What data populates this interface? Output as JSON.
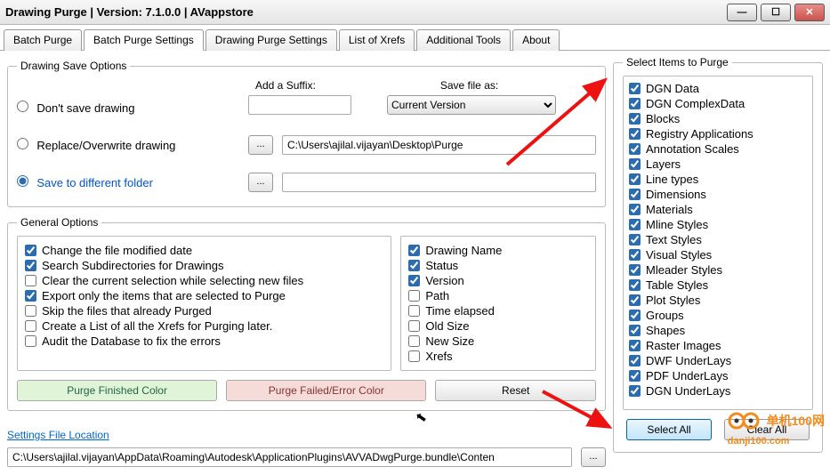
{
  "window": {
    "title": "Drawing Purge  | Version: 7.1.0.0  |  AVappstore"
  },
  "tabs": [
    "Batch Purge",
    "Batch Purge Settings",
    "Drawing Purge Settings",
    "List of Xrefs",
    "Additional Tools",
    "About"
  ],
  "active_tab_index": 1,
  "save_options": {
    "legend": "Drawing Save Options",
    "radio_dont_save": "Don't save drawing",
    "radio_replace": "Replace/Overwrite drawing",
    "radio_savefolder": "Save to different folder",
    "suffix_label": "Add a Suffix:",
    "suffix_value": "",
    "saveas_label": "Save file as:",
    "saveas_value": "Current Version",
    "replace_path": "C:\\Users\\ajilal.vijayan\\Desktop\\Purge",
    "savefolder_path": "",
    "browse_label": "..."
  },
  "general_options": {
    "legend": "General Options",
    "left": [
      {
        "label": "Change the file modified date",
        "checked": true
      },
      {
        "label": "Search Subdirectories for Drawings",
        "checked": true
      },
      {
        "label": "Clear the current selection while selecting new files",
        "checked": false
      },
      {
        "label": "Export only the items that are selected to Purge",
        "checked": true
      },
      {
        "label": "Skip the files that already Purged",
        "checked": false
      },
      {
        "label": "Create a List of all the Xrefs for Purging later.",
        "checked": false
      },
      {
        "label": "Audit the Database to fix the errors",
        "checked": false
      }
    ],
    "right": [
      {
        "label": "Drawing Name",
        "checked": true
      },
      {
        "label": "Status",
        "checked": true
      },
      {
        "label": "Version",
        "checked": true
      },
      {
        "label": "Path",
        "checked": false
      },
      {
        "label": "Time elapsed",
        "checked": false
      },
      {
        "label": "Old Size",
        "checked": false
      },
      {
        "label": "New Size",
        "checked": false
      },
      {
        "label": "Xrefs",
        "checked": false
      }
    ],
    "btn_finished": "Purge Finished Color",
    "btn_failed": "Purge Failed/Error Color",
    "btn_reset": "Reset"
  },
  "settings_file": {
    "link_label": "Settings File Location",
    "path": "C:\\Users\\ajilal.vijayan\\AppData\\Roaming\\Autodesk\\ApplicationPlugins\\AVVADwgPurge.bundle\\Conten",
    "browse_label": "..."
  },
  "purge_items": {
    "legend": "Select Items to Purge",
    "items": [
      "DGN Data",
      "DGN ComplexData",
      "Blocks",
      "Registry Applications",
      "Annotation Scales",
      "Layers",
      "Line types",
      "Dimensions",
      "Materials",
      "Mline Styles",
      "Text Styles",
      "Visual Styles",
      "Mleader Styles",
      "Table Styles",
      "Plot Styles",
      "Groups",
      "Shapes",
      "Raster Images",
      "DWF UnderLays",
      "PDF UnderLays",
      "DGN UnderLays"
    ],
    "btn_select_all": "Select All",
    "btn_clear_all": "Clear All"
  },
  "watermark": {
    "text": "单机100网",
    "url": "danji100.com"
  }
}
